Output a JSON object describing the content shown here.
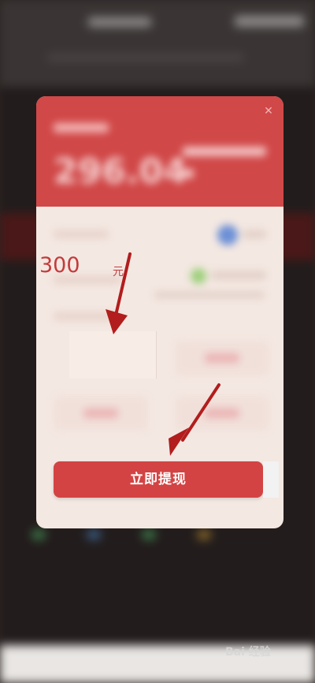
{
  "background": {
    "status_bar_placeholder": "",
    "accent_dark_red": "#4a1818"
  },
  "modal": {
    "balance": "296.04",
    "selected_amount": "300",
    "selected_unit": "元",
    "withdraw_button_label": "立即提现",
    "colors": {
      "header_red": "#d14848",
      "button_red": "#d34343",
      "modal_bg": "#f4e8e2",
      "amount_text": "#c33c3c"
    }
  },
  "annotations": {
    "arrow_color": "#b21d1d",
    "arrows": [
      "arrow-to-amount",
      "arrow-to-withdraw-button"
    ]
  },
  "watermark": {
    "text": "Bai 经验"
  }
}
